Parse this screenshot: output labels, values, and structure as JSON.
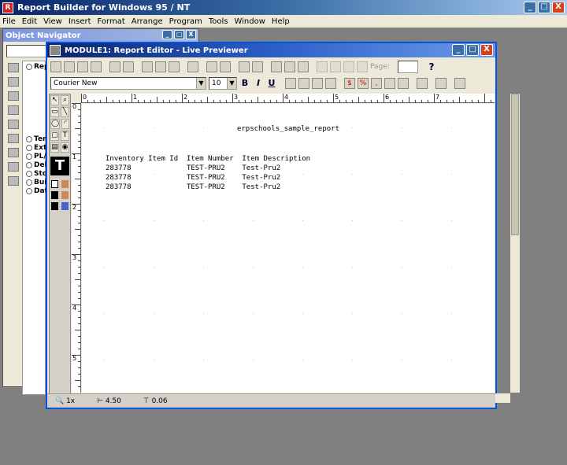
{
  "app": {
    "title": "Report Builder for Windows 95 / NT",
    "menu": [
      "File",
      "Edit",
      "View",
      "Insert",
      "Format",
      "Arrange",
      "Program",
      "Tools",
      "Window",
      "Help"
    ],
    "window_buttons": {
      "minimize": "_",
      "maximize": "□",
      "close": "X"
    }
  },
  "object_navigator": {
    "title": "Object Navigator",
    "tree": [
      {
        "label": "Rep",
        "toggle": "−"
      },
      {
        "label": "Tem"
      },
      {
        "label": "Exte"
      },
      {
        "label": "PL/"
      },
      {
        "label": "Deb"
      },
      {
        "label": "Stor"
      },
      {
        "label": "Buil",
        "toggle": "+"
      },
      {
        "label": "Data",
        "toggle": "+"
      }
    ]
  },
  "editor": {
    "title": "MODULE1: Report Editor - Live Previewer",
    "page_label": "Page:",
    "help_label": "?",
    "font_name": "Courier New",
    "font_size": "10",
    "bold": "B",
    "italic": "I",
    "underline": "U",
    "text_tool": "T",
    "report": {
      "title": "erpschools_sample_report",
      "headers": "Inventory Item Id  Item Number  Item Description",
      "rows": [
        "283778             TEST-PRU2    Test-Pru2",
        "283778             TEST-PRU2    Test-Pru2",
        "283778             TEST-PRU2    Test-Pru2"
      ]
    },
    "ruler_numbers": [
      "0",
      "1",
      "2",
      "3",
      "4",
      "5",
      "6",
      "7"
    ],
    "vertical_ruler_numbers": [
      "0",
      "1",
      "2",
      "3",
      "4",
      "5"
    ],
    "status": {
      "zoom": "1x",
      "x_position": "4.50",
      "y_position": "0.06"
    }
  },
  "colors": {
    "titlebar_active": "#0a246a",
    "window_face": "#ece9d8",
    "desktop": "#808080"
  }
}
